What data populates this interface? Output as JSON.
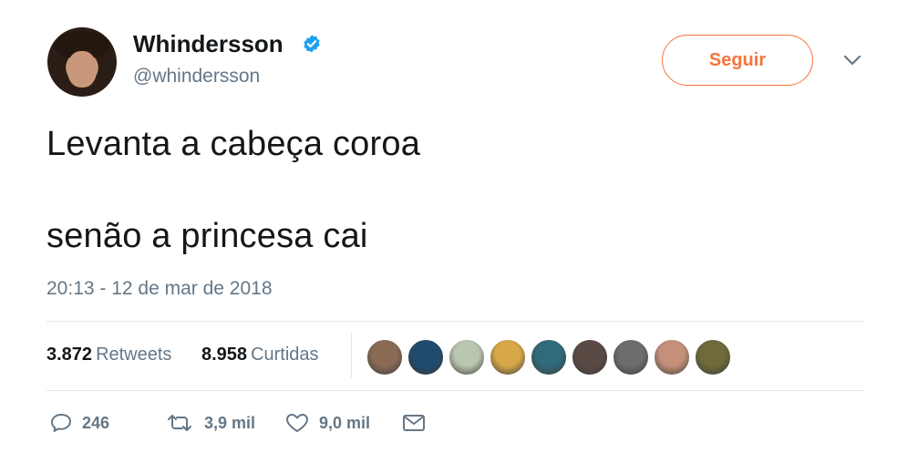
{
  "user": {
    "name": "Whindersson",
    "handle": "@whindersson",
    "verified": true
  },
  "follow_button_label": "Seguir",
  "tweet": {
    "line1": "Levanta a cabeça coroa",
    "line2": "senão a princesa cai"
  },
  "timestamp": "20:13 - 12 de mar de 2018",
  "stats": {
    "retweets_count": "3.872",
    "retweets_label": "Retweets",
    "likes_count": "8.958",
    "likes_label": "Curtidas"
  },
  "actions": {
    "reply_count": "246",
    "retweet_count": "3,9 mil",
    "like_count": "9,0 mil"
  },
  "likers": [
    {
      "color": "#8a6a55"
    },
    {
      "color": "#1e4b6e"
    },
    {
      "color": "#b9c6b0"
    },
    {
      "color": "#d6a848"
    },
    {
      "color": "#2f6b7a"
    },
    {
      "color": "#5a4a44"
    },
    {
      "color": "#6d6d6d"
    },
    {
      "color": "#c4907a"
    },
    {
      "color": "#6e6a3a"
    }
  ],
  "colors": {
    "accent": "#f4753c",
    "verified": "#1da1f2",
    "muted": "#657786"
  }
}
